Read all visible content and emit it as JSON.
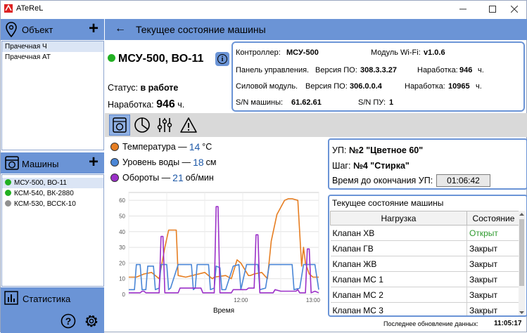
{
  "window": {
    "title": "ATeReL"
  },
  "sidebar": {
    "objects_header": "Объект",
    "objects": [
      {
        "label": "Прачечная Ч",
        "selected": true
      },
      {
        "label": "Прачечная АТ",
        "selected": false
      }
    ],
    "machines_header": "Машины",
    "machines": [
      {
        "label": "МСУ-500, ВО-11",
        "status_color": "#22b022",
        "selected": true
      },
      {
        "label": "КСМ-540, ВК-2880",
        "status_color": "#22b022",
        "selected": false
      },
      {
        "label": "КСМ-530, ВССК-10",
        "status_color": "#909090",
        "selected": false
      }
    ],
    "stats_label": "Статистика"
  },
  "header": {
    "title": "Текущее состояние машины"
  },
  "machine": {
    "name": "МСУ-500, ВО-11",
    "status_color": "#22b022",
    "status_label": "Статус:",
    "status_value": "в работе",
    "hours_label": "Наработка:",
    "hours_value": "946",
    "hours_unit": "ч."
  },
  "controller": {
    "controller_label": "Контроллер:",
    "controller_value": "МСУ-500",
    "wifi_label": "Модуль Wi-Fi:",
    "wifi_value": "v1.0.6",
    "panel_label": "Панель управления.",
    "panel_fw_label": "Версия ПО:",
    "panel_fw_value": "308.3.3.27",
    "panel_hours_label": "Наработка:",
    "panel_hours_value": "946",
    "panel_hours_unit": "ч.",
    "power_label": "Силовой модуль.",
    "power_fw_label": "Версия ПО:",
    "power_fw_value": "306.0.0.4",
    "power_hours_label": "Наработка:",
    "power_hours_value": "10965",
    "power_hours_unit": "ч.",
    "sn_machine_label": "S/N машины:",
    "sn_machine_value": "61.62.61",
    "sn_panel_label": "S/N ПУ:",
    "sn_panel_value": "1"
  },
  "tabs": [
    {
      "icon": "washer-icon",
      "active": true
    },
    {
      "icon": "pie-chart-icon",
      "active": false
    },
    {
      "icon": "sliders-icon",
      "active": false
    },
    {
      "icon": "warning-icon",
      "active": false
    }
  ],
  "legend": [
    {
      "label": "Температура —",
      "value": "14",
      "unit": "°C",
      "color": "#e67e22"
    },
    {
      "label": "Уровень воды —",
      "value": "18",
      "unit": "см",
      "color": "#4a86d6"
    },
    {
      "label": "Обороты —",
      "value": "21",
      "unit": "об/мин",
      "color": "#9b30c8"
    }
  ],
  "program": {
    "up_label": "УП:",
    "up_value": "№2 \"Цветное 60\"",
    "step_label": "Шаг:",
    "step_value": "№4 \"Стирка\"",
    "time_label": "Время до окончания УП:",
    "time_value": "01:06:42"
  },
  "state_table": {
    "title": "Текущее состояние машины",
    "headers": [
      "Нагрузка",
      "Состояние"
    ],
    "rows": [
      {
        "load": "Клапан ХВ",
        "state": "Открыт",
        "color": "#2e9a2e"
      },
      {
        "load": "Клапан ГВ",
        "state": "Закрыт",
        "color": "#000000"
      },
      {
        "load": "Клапан ЖВ",
        "state": "Закрыт",
        "color": "#000000"
      },
      {
        "load": "Клапан МС 1",
        "state": "Закрыт",
        "color": "#000000"
      },
      {
        "load": "Клапан МС 2",
        "state": "Закрыт",
        "color": "#000000"
      },
      {
        "load": "Клапан МС 3",
        "state": "Закрыт",
        "color": "#000000"
      }
    ]
  },
  "footer": {
    "label": "Последнее обновление данных:",
    "time": "11:05:17"
  },
  "chart_data": {
    "type": "line",
    "xlabel": "Время",
    "ylabel": "",
    "x_ticks": [
      "12:00",
      "13:00"
    ],
    "y_ticks": [
      0,
      10,
      20,
      30,
      40,
      50,
      60
    ],
    "ylim": [
      0,
      65
    ],
    "grid": true,
    "series": [
      {
        "name": "Температура",
        "color": "#e67e22",
        "points": [
          [
            0,
            11
          ],
          [
            4,
            11
          ],
          [
            8,
            13
          ],
          [
            12,
            14
          ],
          [
            16,
            10
          ],
          [
            19,
            30
          ],
          [
            21,
            41
          ],
          [
            25,
            41
          ],
          [
            26,
            12
          ],
          [
            30,
            11
          ],
          [
            40,
            14
          ],
          [
            43,
            11
          ],
          [
            44,
            10
          ],
          [
            45,
            11
          ],
          [
            51,
            12
          ],
          [
            54,
            10
          ],
          [
            56,
            18
          ],
          [
            57,
            22
          ],
          [
            59,
            20
          ],
          [
            62,
            14
          ],
          [
            63,
            12
          ],
          [
            64,
            12
          ],
          [
            66,
            13
          ],
          [
            70,
            14
          ],
          [
            73,
            10
          ],
          [
            75,
            34
          ],
          [
            78,
            51
          ],
          [
            82,
            60
          ],
          [
            84,
            61
          ],
          [
            86,
            61
          ],
          [
            89,
            60
          ],
          [
            91,
            18
          ],
          [
            92,
            30
          ],
          [
            93,
            20
          ],
          [
            95,
            13
          ],
          [
            97,
            11
          ],
          [
            100,
            11
          ]
        ]
      },
      {
        "name": "Уровень воды",
        "color": "#4a86d6",
        "points": [
          [
            0,
            3
          ],
          [
            3,
            3
          ],
          [
            4,
            19
          ],
          [
            6,
            19
          ],
          [
            7,
            3
          ],
          [
            9,
            3
          ],
          [
            10,
            18
          ],
          [
            13,
            18
          ],
          [
            14,
            3
          ],
          [
            16,
            4
          ],
          [
            17,
            19
          ],
          [
            20,
            19
          ],
          [
            21,
            3
          ],
          [
            22,
            4
          ],
          [
            26,
            19
          ],
          [
            30,
            19
          ],
          [
            33,
            19
          ],
          [
            34,
            3
          ],
          [
            35,
            4
          ],
          [
            36,
            19
          ],
          [
            40,
            19
          ],
          [
            42,
            19
          ],
          [
            43,
            3
          ],
          [
            45,
            4
          ],
          [
            46,
            18
          ],
          [
            48,
            17
          ],
          [
            49,
            3
          ],
          [
            51,
            3
          ],
          [
            55,
            18
          ],
          [
            58,
            19
          ],
          [
            59,
            3
          ],
          [
            62,
            19
          ],
          [
            68,
            19
          ],
          [
            69,
            3
          ],
          [
            72,
            4
          ],
          [
            74,
            19
          ],
          [
            80,
            19
          ],
          [
            86,
            19
          ],
          [
            87,
            3
          ],
          [
            90,
            4
          ],
          [
            92,
            19
          ],
          [
            98,
            19
          ],
          [
            100,
            3
          ]
        ]
      },
      {
        "name": "Обороты",
        "color": "#9b30c8",
        "points": [
          [
            0,
            1
          ],
          [
            6,
            1
          ],
          [
            7,
            2
          ],
          [
            8,
            2
          ],
          [
            9,
            1
          ],
          [
            16,
            1
          ],
          [
            17,
            37
          ],
          [
            18,
            37
          ],
          [
            19,
            1
          ],
          [
            26,
            1
          ],
          [
            27,
            4
          ],
          [
            38,
            4
          ],
          [
            39,
            1
          ],
          [
            45,
            1
          ],
          [
            46,
            56
          ],
          [
            47,
            56
          ],
          [
            48,
            1
          ],
          [
            54,
            1
          ],
          [
            55,
            3
          ],
          [
            62,
            3
          ],
          [
            63,
            4
          ],
          [
            66,
            4
          ],
          [
            67,
            38
          ],
          [
            68,
            38
          ],
          [
            69,
            1
          ],
          [
            76,
            1
          ],
          [
            77,
            3
          ],
          [
            80,
            2
          ],
          [
            88,
            2
          ],
          [
            89,
            3
          ],
          [
            90,
            1
          ],
          [
            93,
            1
          ],
          [
            94,
            29
          ],
          [
            95,
            29
          ],
          [
            96,
            1
          ],
          [
            98,
            2
          ],
          [
            100,
            1
          ]
        ]
      }
    ]
  }
}
